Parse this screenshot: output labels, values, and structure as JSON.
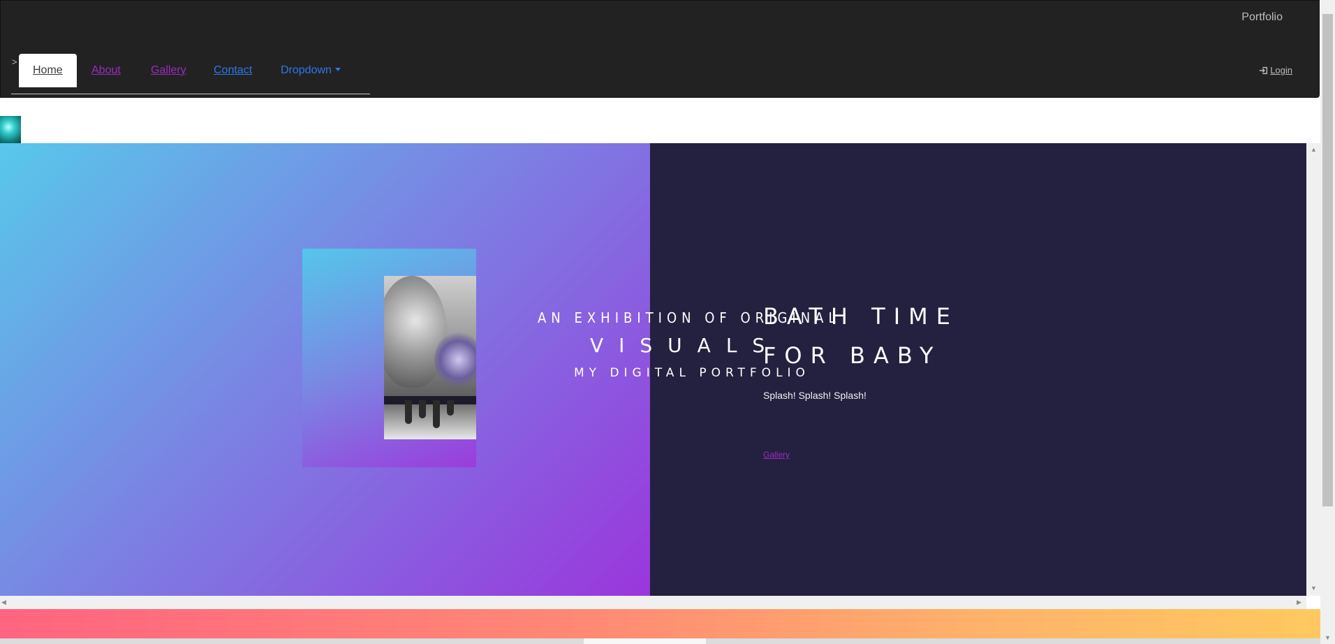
{
  "navbar": {
    "brand": "Portfolio",
    "prefix": ">",
    "tabs": [
      {
        "label": "Home"
      },
      {
        "label": "About"
      },
      {
        "label": "Gallery"
      },
      {
        "label": "Contact"
      },
      {
        "label": "Dropdown"
      }
    ],
    "login": "Login"
  },
  "hero": {
    "exhibit": "AN EXHIBITION OF ORIGINAL",
    "visuals": "VISUALS",
    "subtitle": "MY DIGITAL PORTFOLIO",
    "feature_title": "BATH TIME FOR BABY",
    "feature_text": "Splash! Splash! Splash!",
    "feature_link": "Gallery"
  },
  "colors": {
    "navbar_bg": "#222222",
    "link_visited": "#9b2cc2",
    "link_blue": "#2f77e8",
    "hero_right_bg": "#24203f",
    "gradient_start": "#58c8ea",
    "gradient_end": "#9a36dc",
    "footer_start": "#ff6480",
    "footer_end": "#ffc95f"
  },
  "icons": {
    "login": "sign-in-icon",
    "dropdown": "caret-down-icon"
  }
}
